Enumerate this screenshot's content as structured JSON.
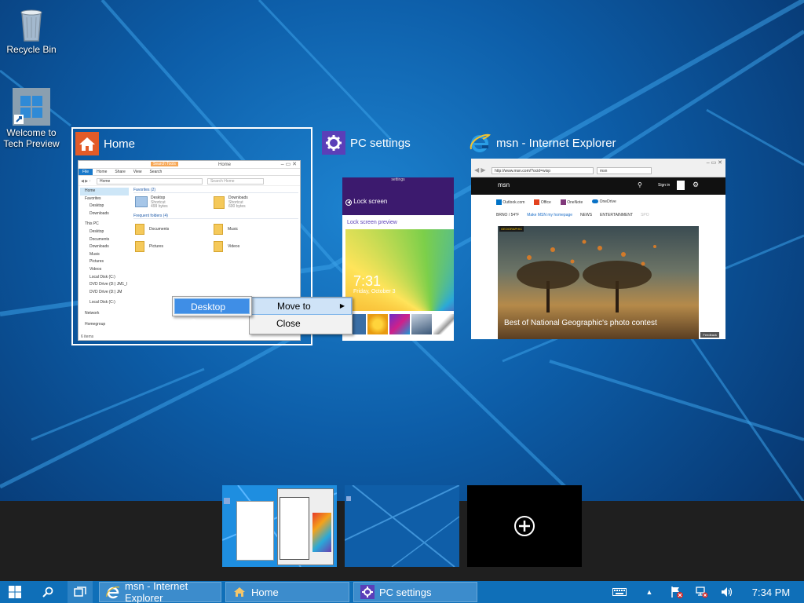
{
  "desktop_icons": [
    {
      "label": "Recycle Bin",
      "icon": "recycle-bin-icon"
    },
    {
      "label_line1": "Welcome to",
      "label_line2": "Tech Preview",
      "icon": "windows-logo-shortcut-icon"
    }
  ],
  "task_view": {
    "windows": [
      {
        "title": "Home",
        "icon": "file-explorer-home-icon",
        "selected": true
      },
      {
        "title": "PC settings",
        "icon": "gear-icon"
      },
      {
        "title": "msn - Internet Explorer",
        "icon": "internet-explorer-icon"
      }
    ]
  },
  "explorer_thumb": {
    "tab_file": "File",
    "tab_home": "Home",
    "tab_share": "Share",
    "tab_view": "View",
    "search_tools": "Search Tools",
    "window_title": "Home",
    "address": "Home",
    "search_placeholder": "Search Home",
    "nav": [
      "Home",
      "Favorites",
      "Desktop",
      "Downloads",
      "This PC",
      "Desktop",
      "Documents",
      "Downloads",
      "Music",
      "Pictures",
      "Videos",
      "Local Disk (C:)",
      "DVD Drive (D:) JM1_I",
      "DVD Drive (D:) JM",
      "Local Disk (C:)",
      "Network",
      "Homegroup"
    ],
    "favorites_header": "Favorites (2)",
    "favorites": [
      {
        "name": "Desktop",
        "sub1": "Shortcut",
        "sub2": "499 bytes"
      },
      {
        "name": "Downloads",
        "sub1": "Shortcut",
        "sub2": "600 bytes"
      }
    ],
    "frequent_header": "Frequent folders (4)",
    "frequent": [
      "Documents",
      "Music",
      "Pictures",
      "Videos"
    ],
    "status": "6 items"
  },
  "settings_thumb": {
    "titlebar": "settings",
    "header": "Lock screen",
    "subheader": "Lock screen preview",
    "time": "7:31",
    "date": "Friday, October 3"
  },
  "ie_thumb": {
    "url": "http://www.msn.com/?ocid=wisp",
    "tab": "msn",
    "logo": "msn",
    "signin": "Sign in",
    "links": [
      "Outlook.com",
      "Office",
      "OneNote",
      "OneDrive"
    ],
    "weather": "BRNO / 54°F",
    "homepage_link": "Make MSN my homepage",
    "nav": [
      "NEWS",
      "ENTERTAINMENT",
      "SPO"
    ],
    "photo_badge": "GEOGRAPHIC",
    "caption": "Best of National Geographic's photo contest",
    "feedback": "Feedback"
  },
  "context_menu": {
    "items": [
      {
        "label": "Move to",
        "has_submenu": true
      },
      {
        "label": "Close"
      }
    ],
    "submenu": [
      {
        "label": "Desktop 2"
      }
    ]
  },
  "virtual_desktops": {
    "add_icon": "plus-circle-icon"
  },
  "taskbar": {
    "apps": [
      {
        "label": "msn - Internet Explorer",
        "icon": "internet-explorer-icon"
      },
      {
        "label": "Home",
        "icon": "file-explorer-home-icon"
      },
      {
        "label": "PC settings",
        "icon": "gear-icon"
      }
    ],
    "clock": "7:34 PM"
  },
  "colors": {
    "taskbar": "#0f6fb8",
    "selection": "#3f8ee6",
    "settings_purple": "#3c1a6e",
    "home_icon_orange": "#e35b28"
  }
}
